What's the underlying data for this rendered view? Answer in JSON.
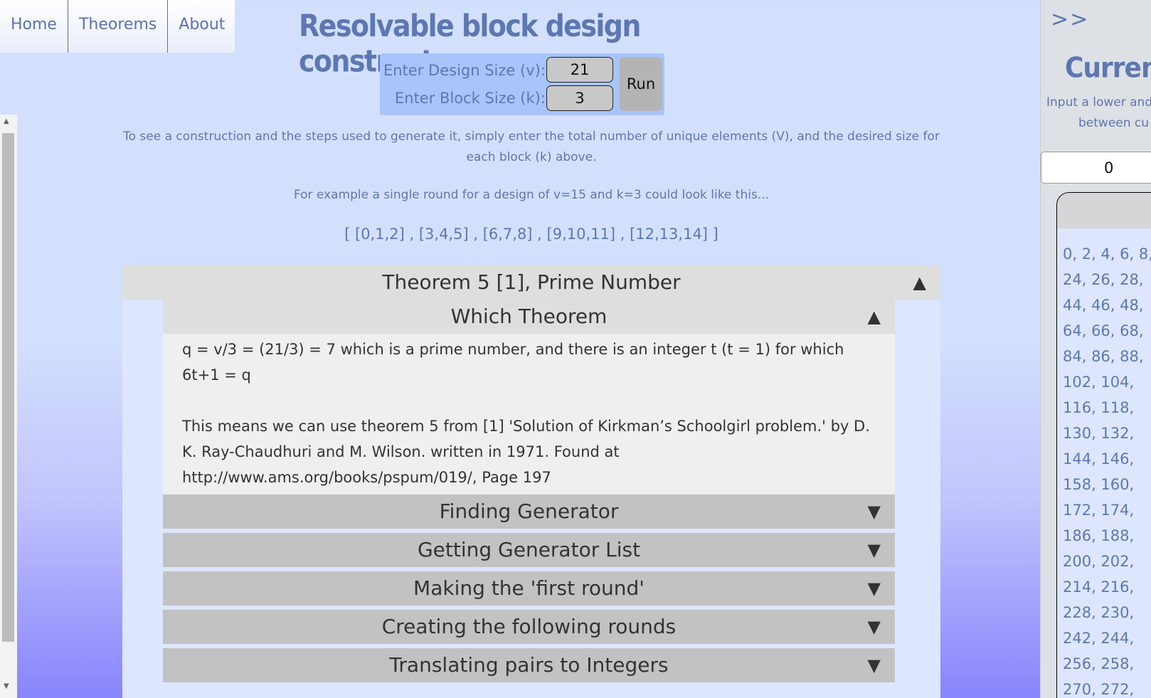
{
  "nav": {
    "items": [
      "Home",
      "Theorems",
      "About"
    ]
  },
  "title": "Resolvable block design constructor",
  "form": {
    "design_size_label": "Enter Design Size (v):",
    "design_size_value": "21",
    "block_size_label": "Enter Block Size (k):",
    "block_size_value": "3",
    "run_label": "Run"
  },
  "description": "To see a construction and the steps used to generate it, simply enter the total number of unique elements (V), and the desired size for each block (k) above.",
  "example_intro": "For example a single round for a design of v=15 and k=3 could look like this...",
  "example_round": "[ [0,1,2] , [3,4,5] , [6,7,8] , [9,10,11] , [12,13,14] ]",
  "theorem": {
    "header": "Theorem 5 [1], Prime Number",
    "which": {
      "header": "Which Theorem",
      "para1": "q = v/3 = (21/3) = 7 which is a prime number, and there is an integer t (t = 1) for which 6t+1 = q",
      "para2": "This means we can use theorem 5 from [1] 'Solution of Kirkman’s Schoolgirl problem.' by D. K. Ray-Chaudhuri and M. Wilson. written in 1971. Found at http://www.ams.org/books/pspum/019/, Page 197"
    },
    "sections": [
      "Finding Generator",
      "Getting Generator List",
      "Making the 'first round'",
      "Creating the following rounds",
      "Translating pairs to Integers"
    ]
  },
  "right_panel": {
    "toggle": ">>",
    "title": "Current",
    "desc_line1": "Input a lower and",
    "desc_line2": "between cu",
    "lower_value": "0",
    "rows": [
      "0,  2,  4,  6,  8,",
      "24,  26,  28,",
      "44,  46,  48,",
      "64,  66,  68,",
      "84,  86,  88,",
      "102,  104,",
      "116,  118,",
      "130,  132,",
      "144,  146,",
      "158,  160,",
      "172,  174,",
      "186,  188,",
      "200,  202,",
      "214,  216,",
      "228,  230,",
      "242,  244,",
      "256,  258,",
      "270,  272,"
    ]
  }
}
